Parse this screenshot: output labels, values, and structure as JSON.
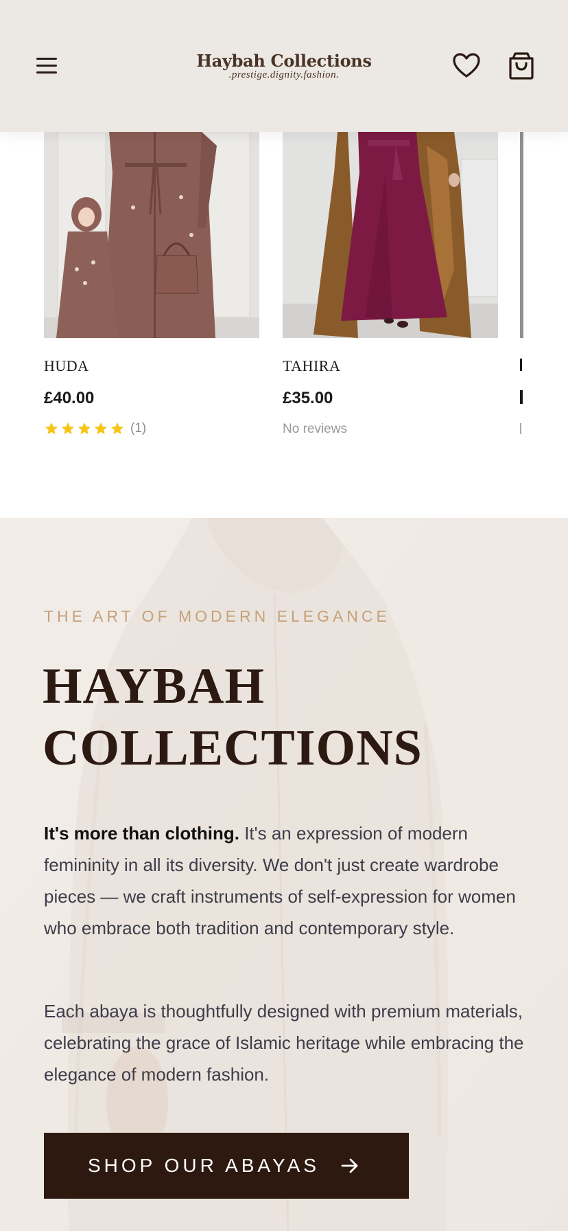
{
  "header": {
    "logo_title": "Haybah Collections",
    "logo_tagline": ".prestige.dignity.fashion.",
    "menu_icon": "hamburger-menu-icon",
    "wishlist_icon": "heart-icon",
    "cart_icon": "shopping-bag-icon"
  },
  "products": [
    {
      "name": "HUDA",
      "price": "£40.00",
      "rating_stars": 5,
      "review_count": "(1)"
    },
    {
      "name": "TAHIRA",
      "price": "£35.00",
      "reviews_text": "No reviews"
    }
  ],
  "about": {
    "eyebrow": "THE ART OF MODERN ELEGANCE",
    "heading_line1": "HAYBAH",
    "heading_line2": "COLLECTIONS",
    "para1_bold": "It's more than clothing.",
    "para1_rest": " It's an expression of modern femininity in all its diversity. We don't just create wardrobe pieces — we craft instruments of self-expression for women who embrace both tradition and contemporary style.",
    "para2": "Each abaya is thoughtfully designed with premium materials, celebrating the grace of Islamic heritage while embracing the elegance of modern fashion.",
    "cta_label": "SHOP OUR ABAYAS",
    "cta_icon": "arrow-right-icon"
  },
  "colors": {
    "header_bg": "#ece8e3",
    "brand_dark": "#2e1911",
    "accent_gold": "#c4a27a",
    "star_yellow": "#f5c518"
  }
}
